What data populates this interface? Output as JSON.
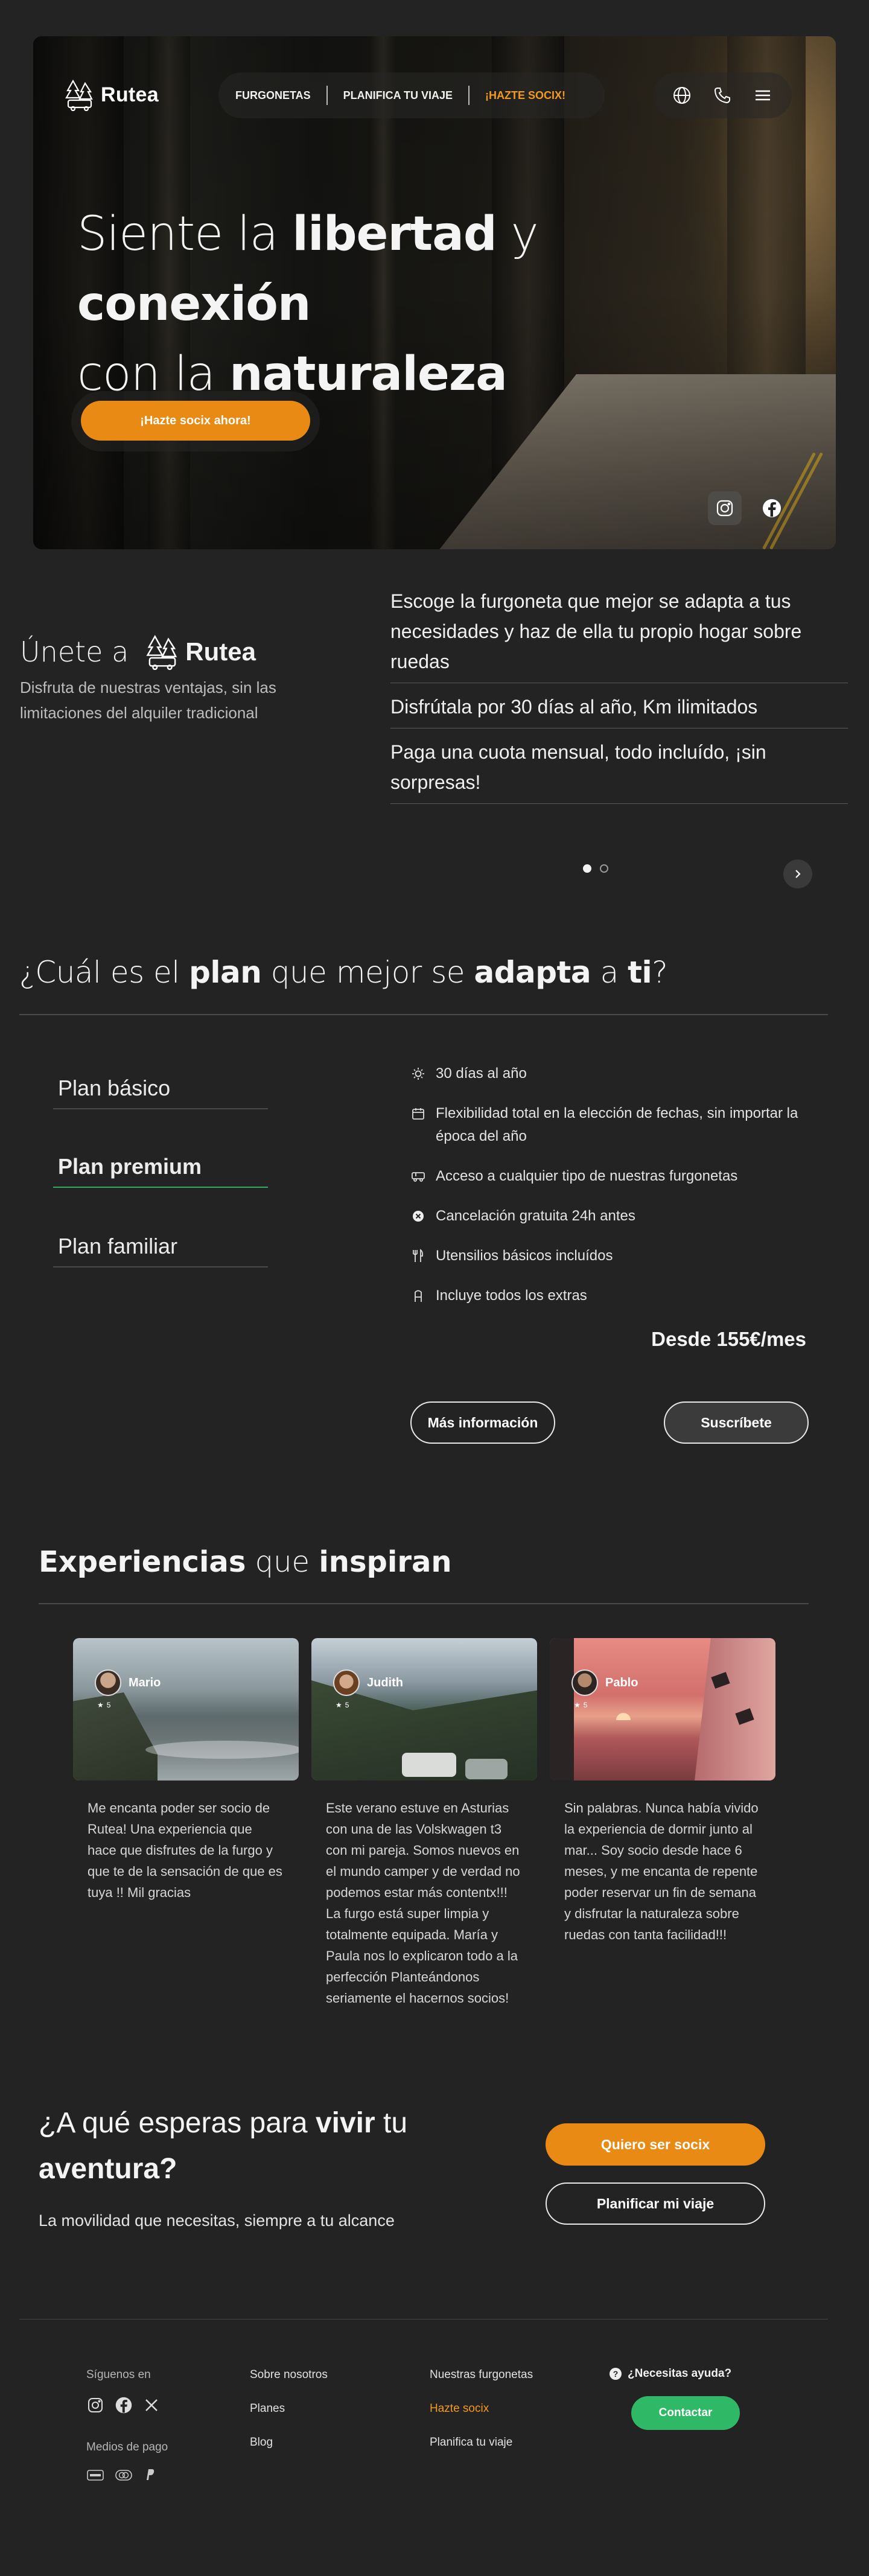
{
  "brand": {
    "name": "Rutea"
  },
  "nav": {
    "items": [
      {
        "label": "FURGONETAS"
      },
      {
        "label": "PLANIFICA TU VIAJE"
      },
      {
        "label": "¡HAZTE SOCIX!"
      }
    ],
    "icons": [
      "globe-icon",
      "phone-icon",
      "menu-icon"
    ]
  },
  "hero": {
    "title_1": "Siente la ",
    "title_2": "libertad",
    "title_3": " y ",
    "title_4": "conexión",
    "title_5": "con la ",
    "title_6": "naturaleza",
    "cta_label": "¡Hazte socix ahora!",
    "social_icons": [
      "instagram-icon",
      "facebook-icon"
    ]
  },
  "join": {
    "title_prefix": "Únete a",
    "subtitle": "Disfruta de nuestras ventajas, sin las limitaciones del alquiler tradicional",
    "features": [
      "Escoge la furgoneta que mejor se adapta a tus necesidades y haz de ella tu propio hogar sobre ruedas",
      "Disfrútala por 30 días al año, Km ilimitados",
      "Paga una cuota mensual, todo incluído, ¡sin sorpresas!"
    ],
    "carousel": {
      "slides": 2,
      "active": 1
    }
  },
  "plans": {
    "title_1": "¿Cuál es el ",
    "title_2": "plan",
    "title_3": " que mejor se ",
    "title_4": "adapta",
    "title_5": " a ",
    "title_6": "ti",
    "title_7": "?",
    "tabs": [
      {
        "label": "Plan básico"
      },
      {
        "label": "Plan premium"
      },
      {
        "label": "Plan familiar"
      }
    ],
    "active_tab": 1,
    "features": [
      {
        "icon": "sun-icon",
        "text": "30 días al año"
      },
      {
        "icon": "calendar-icon",
        "text": "Flexibilidad total en la elección de fechas, sin importar la época del año"
      },
      {
        "icon": "van-icon",
        "text": "Acceso a cualquier tipo de nuestras furgonetas"
      },
      {
        "icon": "close-circle-icon",
        "text": "Cancelación gratuita 24h antes"
      },
      {
        "icon": "utensils-icon",
        "text": "Utensilios básicos incluídos"
      },
      {
        "icon": "plus-icon",
        "text": "Incluye todos los extras"
      }
    ],
    "price": "Desde 155€/mes",
    "more_info_label": "Más información",
    "subscribe_label": "Suscríbete"
  },
  "experiences": {
    "title_1": "Experiencias",
    "title_2": " que ",
    "title_3": "inspiran",
    "cards": [
      {
        "name": "Mario",
        "rating": "5",
        "text": "Me encanta poder ser socio de Rutea! Una experiencia que hace que disfrutes de la furgo y que te de la sensación de que es tuya !! Mil gracias"
      },
      {
        "name": "Judith",
        "rating": "5",
        "text": "Este verano estuve en Asturias con una de las Volskwagen t3 con mi pareja. Somos nuevos en el mundo camper y de verdad no podemos estar más contentx!!! La furgo está super limpia y totalmente equipada. María y Paula nos lo explicaron todo a la perfección Planteándonos seriamente el hacernos socios!"
      },
      {
        "name": "Pablo",
        "rating": "5",
        "text": "Sin palabras. Nunca había vivido la experiencia de dormir junto al mar... Soy socio desde hace 6 meses, y me encanta de repente poder reservar un fin de semana y disfrutar la naturaleza sobre ruedas con tanta facilidad!!!"
      }
    ]
  },
  "cta": {
    "title_1": "¿A qué esperas para ",
    "title_2": "vivir",
    "title_3": " tu ",
    "title_4": "aventura?",
    "subtitle": "La movilidad que necesitas, siempre a tu alcance",
    "primary_label": "Quiero ser socix",
    "secondary_label": "Planificar mi viaje"
  },
  "footer": {
    "follow_label": "Síguenos en",
    "social_icons": [
      "instagram-icon",
      "facebook-icon",
      "x-icon"
    ],
    "payment_label": "Medios de pago",
    "payment_icons": [
      "visa-icon",
      "mastercard-icon",
      "paypal-icon"
    ],
    "col1": [
      "Sobre nosotros",
      "Planes",
      "Blog"
    ],
    "col2": [
      "Nuestras furgonetas",
      "Hazte socix",
      "Planifica tu viaje"
    ],
    "help_label": "¿Necesitas ayuda?",
    "contact_label": "Contactar"
  },
  "colors": {
    "background": "#232323",
    "accent_orange": "#e98a14",
    "accent_green": "#2fb866",
    "text": "#f0f0f0"
  }
}
